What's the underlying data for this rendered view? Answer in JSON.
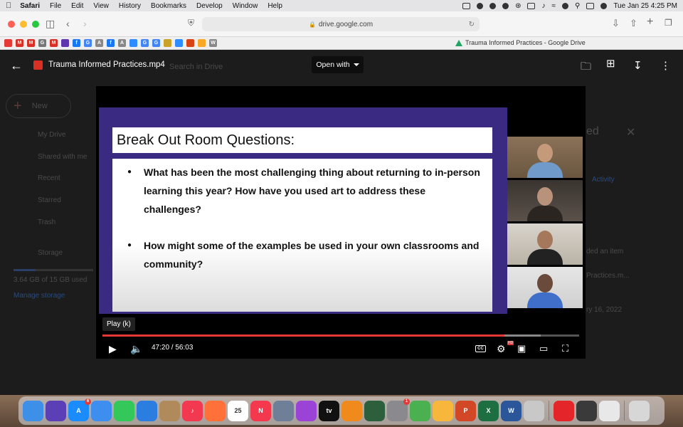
{
  "menubar": {
    "items": [
      "Safari",
      "File",
      "Edit",
      "View",
      "History",
      "Bookmarks",
      "Develop",
      "Window",
      "Help"
    ],
    "clock": "Tue Jan 25  4:25 PM"
  },
  "toolbar": {
    "url": "drive.google.com"
  },
  "bookmarks": {
    "favicons": [
      {
        "icon": "youtube-icon",
        "color": "#e53935",
        "label": ""
      },
      {
        "icon": "gmail-icon",
        "color": "#d93025",
        "label": "M"
      },
      {
        "icon": "gmail-icon",
        "color": "#d93025",
        "label": "M"
      },
      {
        "icon": "g-icon",
        "color": "#777777",
        "label": "G"
      },
      {
        "icon": "gmail-icon",
        "color": "#d93025",
        "label": "M"
      },
      {
        "icon": "list-icon",
        "color": "#5e35b1",
        "label": ""
      },
      {
        "icon": "facebook-icon",
        "color": "#1877f2",
        "label": "f"
      },
      {
        "icon": "google-icon",
        "color": "#4285f4",
        "label": "G"
      },
      {
        "icon": "a-icon",
        "color": "#888888",
        "label": "A"
      },
      {
        "icon": "facebook-icon",
        "color": "#1877f2",
        "label": "f"
      },
      {
        "icon": "a-icon",
        "color": "#888888",
        "label": "A"
      },
      {
        "icon": "zoom-icon",
        "color": "#2d8cff",
        "label": ""
      },
      {
        "icon": "google-icon",
        "color": "#4285f4",
        "label": "G"
      },
      {
        "icon": "google-icon",
        "color": "#4285f4",
        "label": "G"
      },
      {
        "icon": "bookmark-icon",
        "color": "#c9a227",
        "label": ""
      },
      {
        "icon": "zoom-icon",
        "color": "#2d8cff",
        "label": ""
      },
      {
        "icon": "bookmark-icon",
        "color": "#d84315",
        "label": ""
      },
      {
        "icon": "bookmark-icon",
        "color": "#f9a825",
        "label": ""
      },
      {
        "icon": "w-icon",
        "color": "#888888",
        "label": "W"
      }
    ],
    "tab_title": "Trauma Informed Practices - Google Drive"
  },
  "drive": {
    "new_label": "New",
    "search_placeholder": "Search in Drive",
    "nav": [
      "My Drive",
      "Shared with me",
      "Recent",
      "Starred",
      "Trash",
      "Storage"
    ],
    "storage_text": "3.64 GB of 15 GB used",
    "manage_storage": "Manage storage",
    "panel_heading": "ed",
    "activity_tab": "Activity",
    "activity_line1": "ded an item",
    "activity_line2": "Practices.m...",
    "activity_date": "ry 16, 2022"
  },
  "viewer": {
    "file_name": "Trauma Informed Practices.mp4",
    "open_with": "Open with"
  },
  "slide": {
    "title": "Break Out Room Questions:",
    "bullets": [
      "What has been the most challenging thing about returning to in-person learning this year? How have you used art to address these challenges?",
      "How might some of the examples be used in your own classrooms and community?"
    ]
  },
  "player": {
    "tooltip": "Play (k)",
    "time": "47:20 / 56:03",
    "progress_fraction": 0.843,
    "cc": "CC",
    "hd": "HD"
  },
  "dock": {
    "apps": [
      {
        "icon": "finder-icon",
        "color": "#3d8fe8",
        "label": "",
        "badge": ""
      },
      {
        "icon": "siri-icon",
        "color": "#5b3fb6",
        "label": "",
        "badge": ""
      },
      {
        "icon": "app-store-icon",
        "color": "#1a8cff",
        "label": "A",
        "badge": "6"
      },
      {
        "icon": "mail-icon",
        "color": "#3e8ef0",
        "label": "",
        "badge": ""
      },
      {
        "icon": "messages-icon",
        "color": "#34c759",
        "label": "",
        "badge": ""
      },
      {
        "icon": "safari-icon",
        "color": "#2c7de0",
        "label": "",
        "badge": ""
      },
      {
        "icon": "contacts-icon",
        "color": "#b08a5a",
        "label": "",
        "badge": ""
      },
      {
        "icon": "music-icon",
        "color": "#f2394f",
        "label": "♪",
        "badge": ""
      },
      {
        "icon": "firefox-icon",
        "color": "#ff7139",
        "label": "",
        "badge": ""
      },
      {
        "icon": "calendar-icon",
        "color": "#ffffff",
        "label": "25",
        "badge": ""
      },
      {
        "icon": "news-icon",
        "color": "#f4384d",
        "label": "N",
        "badge": ""
      },
      {
        "icon": "preview-icon",
        "color": "#6f7f97",
        "label": "",
        "badge": ""
      },
      {
        "icon": "podcasts-icon",
        "color": "#9b43d6",
        "label": "",
        "badge": ""
      },
      {
        "icon": "tv-icon",
        "color": "#111111",
        "label": "tv",
        "badge": ""
      },
      {
        "icon": "books-icon",
        "color": "#f08a1c",
        "label": "",
        "badge": ""
      },
      {
        "icon": "time-machine-icon",
        "color": "#2d5f3d",
        "label": "",
        "badge": ""
      },
      {
        "icon": "system-preferences-icon",
        "color": "#8a8a8e",
        "label": "",
        "badge": "1"
      },
      {
        "icon": "maps-icon",
        "color": "#4bb04f",
        "label": "",
        "badge": ""
      },
      {
        "icon": "photos-icon",
        "color": "#f6b73c",
        "label": "",
        "badge": ""
      },
      {
        "icon": "powerpoint-icon",
        "color": "#d24726",
        "label": "P",
        "badge": ""
      },
      {
        "icon": "excel-icon",
        "color": "#1d6f42",
        "label": "X",
        "badge": ""
      },
      {
        "icon": "word-icon",
        "color": "#2b579a",
        "label": "W",
        "badge": ""
      },
      {
        "icon": "utilities-icon",
        "color": "#c8c8c8",
        "label": "",
        "badge": ""
      },
      {
        "icon": "acrobat-icon",
        "color": "#e4262a",
        "label": "",
        "badge": ""
      },
      {
        "icon": "calculator-icon",
        "color": "#3a3a3a",
        "label": "",
        "badge": ""
      },
      {
        "icon": "textedit-icon",
        "color": "#e8e8e8",
        "label": "",
        "badge": ""
      },
      {
        "icon": "trash-icon",
        "color": "#d7d7d7",
        "label": "",
        "badge": ""
      }
    ]
  }
}
